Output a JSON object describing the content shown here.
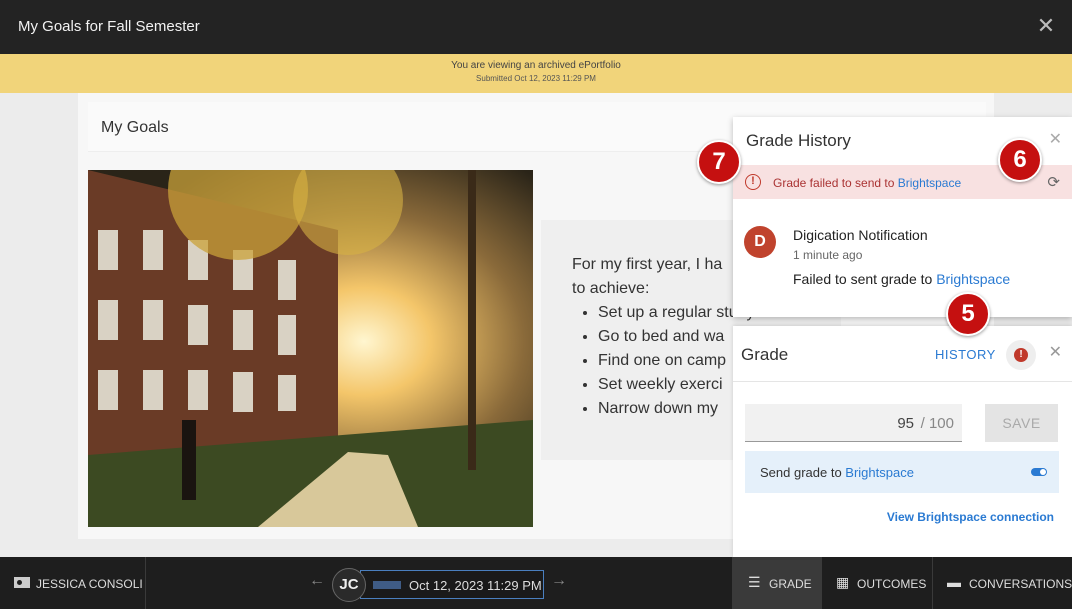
{
  "window": {
    "title": "My Goals for Fall Semester"
  },
  "banner": {
    "line1": "You are viewing an archived ePortfolio",
    "line2": "Submitted Oct 12, 2023 11:29 PM"
  },
  "page": {
    "section_title": "My Goals",
    "intro_line1": "For my first year, I ha",
    "intro_line2": "to achieve:",
    "goals": [
      "Set up a regular study routine",
      "Go to bed and wa",
      "Find one on camp",
      "Set weekly exerci",
      "Narrow down my"
    ]
  },
  "grade_history": {
    "title": "Grade History",
    "error_text": "Grade failed to send to ",
    "error_link": "Brightspace",
    "item_avatar": "D",
    "item_name": "Digication Notification",
    "item_time": "1 minute ago",
    "item_msg": "Failed to sent grade to ",
    "item_link": "Brightspace"
  },
  "grade": {
    "title": "Grade",
    "history_label": "HISTORY",
    "score": "95",
    "max": "/ 100",
    "save_label": "SAVE",
    "send_label": "Send grade to ",
    "send_link": "Brightspace",
    "view_connection": "View Brightspace connection"
  },
  "badges": {
    "b5": "5",
    "b6": "6",
    "b7": "7"
  },
  "bottom": {
    "student_name": "JESSICA CONSOLI",
    "avatar_initials": "JC",
    "date": "Oct 12, 2023 11:29 PM",
    "tab_grade": "GRADE",
    "tab_outcomes": "OUTCOMES",
    "tab_conversations": "CONVERSATIONS"
  },
  "colors": {
    "accent": "#2a7ad2",
    "badge": "#c51010",
    "banner": "#f1d47a",
    "error_bg": "#f8e1e1"
  }
}
